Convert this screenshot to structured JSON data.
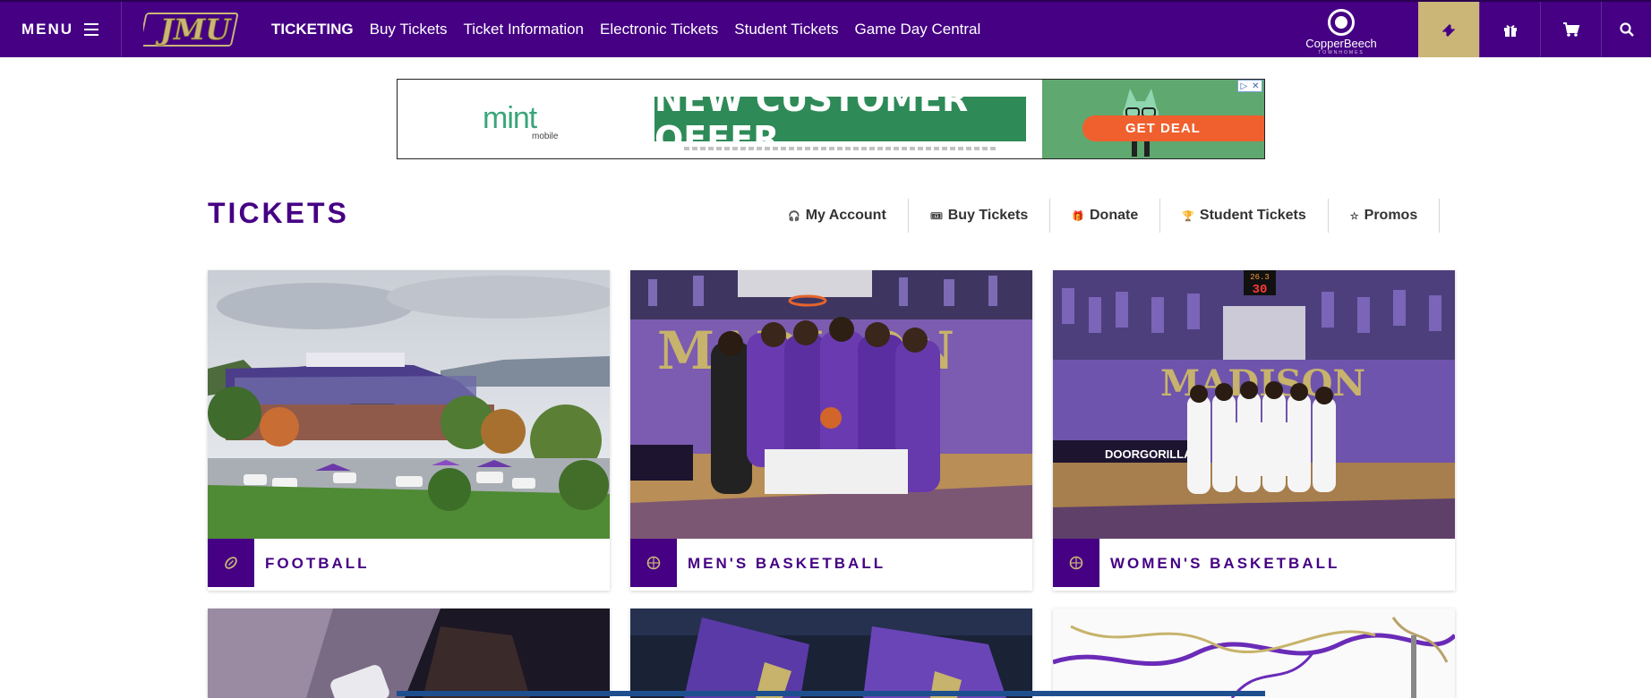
{
  "topbar": {
    "menu_label": "MENU",
    "logo_text": "JMU",
    "nav_links": [
      "TICKETING",
      "Buy Tickets",
      "Ticket Information",
      "Electronic Tickets",
      "Student Tickets",
      "Game Day Central"
    ],
    "sponsor_name": "CopperBeech",
    "sponsor_sub": "TOWNHOMES",
    "icons": [
      "ticket-icon",
      "gift-icon",
      "cart-icon",
      "search-icon"
    ]
  },
  "ad": {
    "brand": "mint",
    "brand_sub": "mobile",
    "headline": "NEW CUSTOMER OFFER",
    "cta": "GET DEAL"
  },
  "page": {
    "title": "TICKETS",
    "sub_nav": [
      {
        "icon": "headset-icon",
        "glyph": "🎧",
        "label": "My Account"
      },
      {
        "icon": "ticket-icon",
        "glyph": "🎟",
        "label": "Buy Tickets"
      },
      {
        "icon": "gift-icon",
        "glyph": "🎁",
        "label": "Donate"
      },
      {
        "icon": "trophy-icon",
        "glyph": "🏆",
        "label": "Student Tickets"
      },
      {
        "icon": "star-icon",
        "glyph": "☆",
        "label": "Promos"
      }
    ]
  },
  "cards": [
    {
      "label": "FOOTBALL",
      "icon": "football-icon"
    },
    {
      "label": "MEN'S BASKETBALL",
      "icon": "basketball-icon"
    },
    {
      "label": "WOMEN'S BASKETBALL",
      "icon": "basketball-icon"
    }
  ],
  "scoreboard": {
    "top": "26.3",
    "bottom": "30"
  },
  "colors": {
    "brand_purple": "#450084",
    "brand_gold": "#CBB677"
  }
}
